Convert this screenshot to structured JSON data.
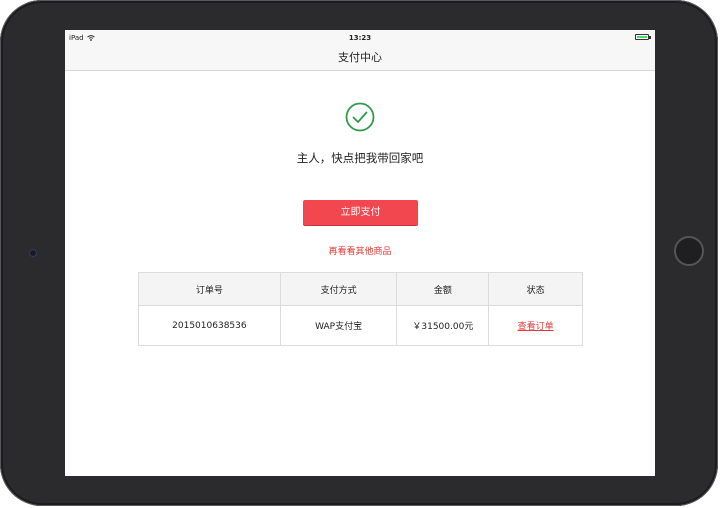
{
  "status_bar": {
    "device": "iPad",
    "time": "13:23",
    "wifi_icon": "wifi-icon",
    "battery_icon": "battery-icon"
  },
  "nav": {
    "title": "支付中心"
  },
  "success": {
    "icon": "check-circle-icon",
    "message": "主人，快点把我带回家吧",
    "icon_color": "#2e9b4f"
  },
  "actions": {
    "pay_label": "立即支付",
    "more_label": "再看看其他商品",
    "accent_color": "#f2474e"
  },
  "table": {
    "headers": [
      "订单号",
      "支付方式",
      "金额",
      "状态"
    ],
    "rows": [
      {
        "order_no": "2015010638536",
        "method": "WAP支付宝",
        "amount": "￥31500.00元",
        "status": "查看订单"
      }
    ]
  }
}
